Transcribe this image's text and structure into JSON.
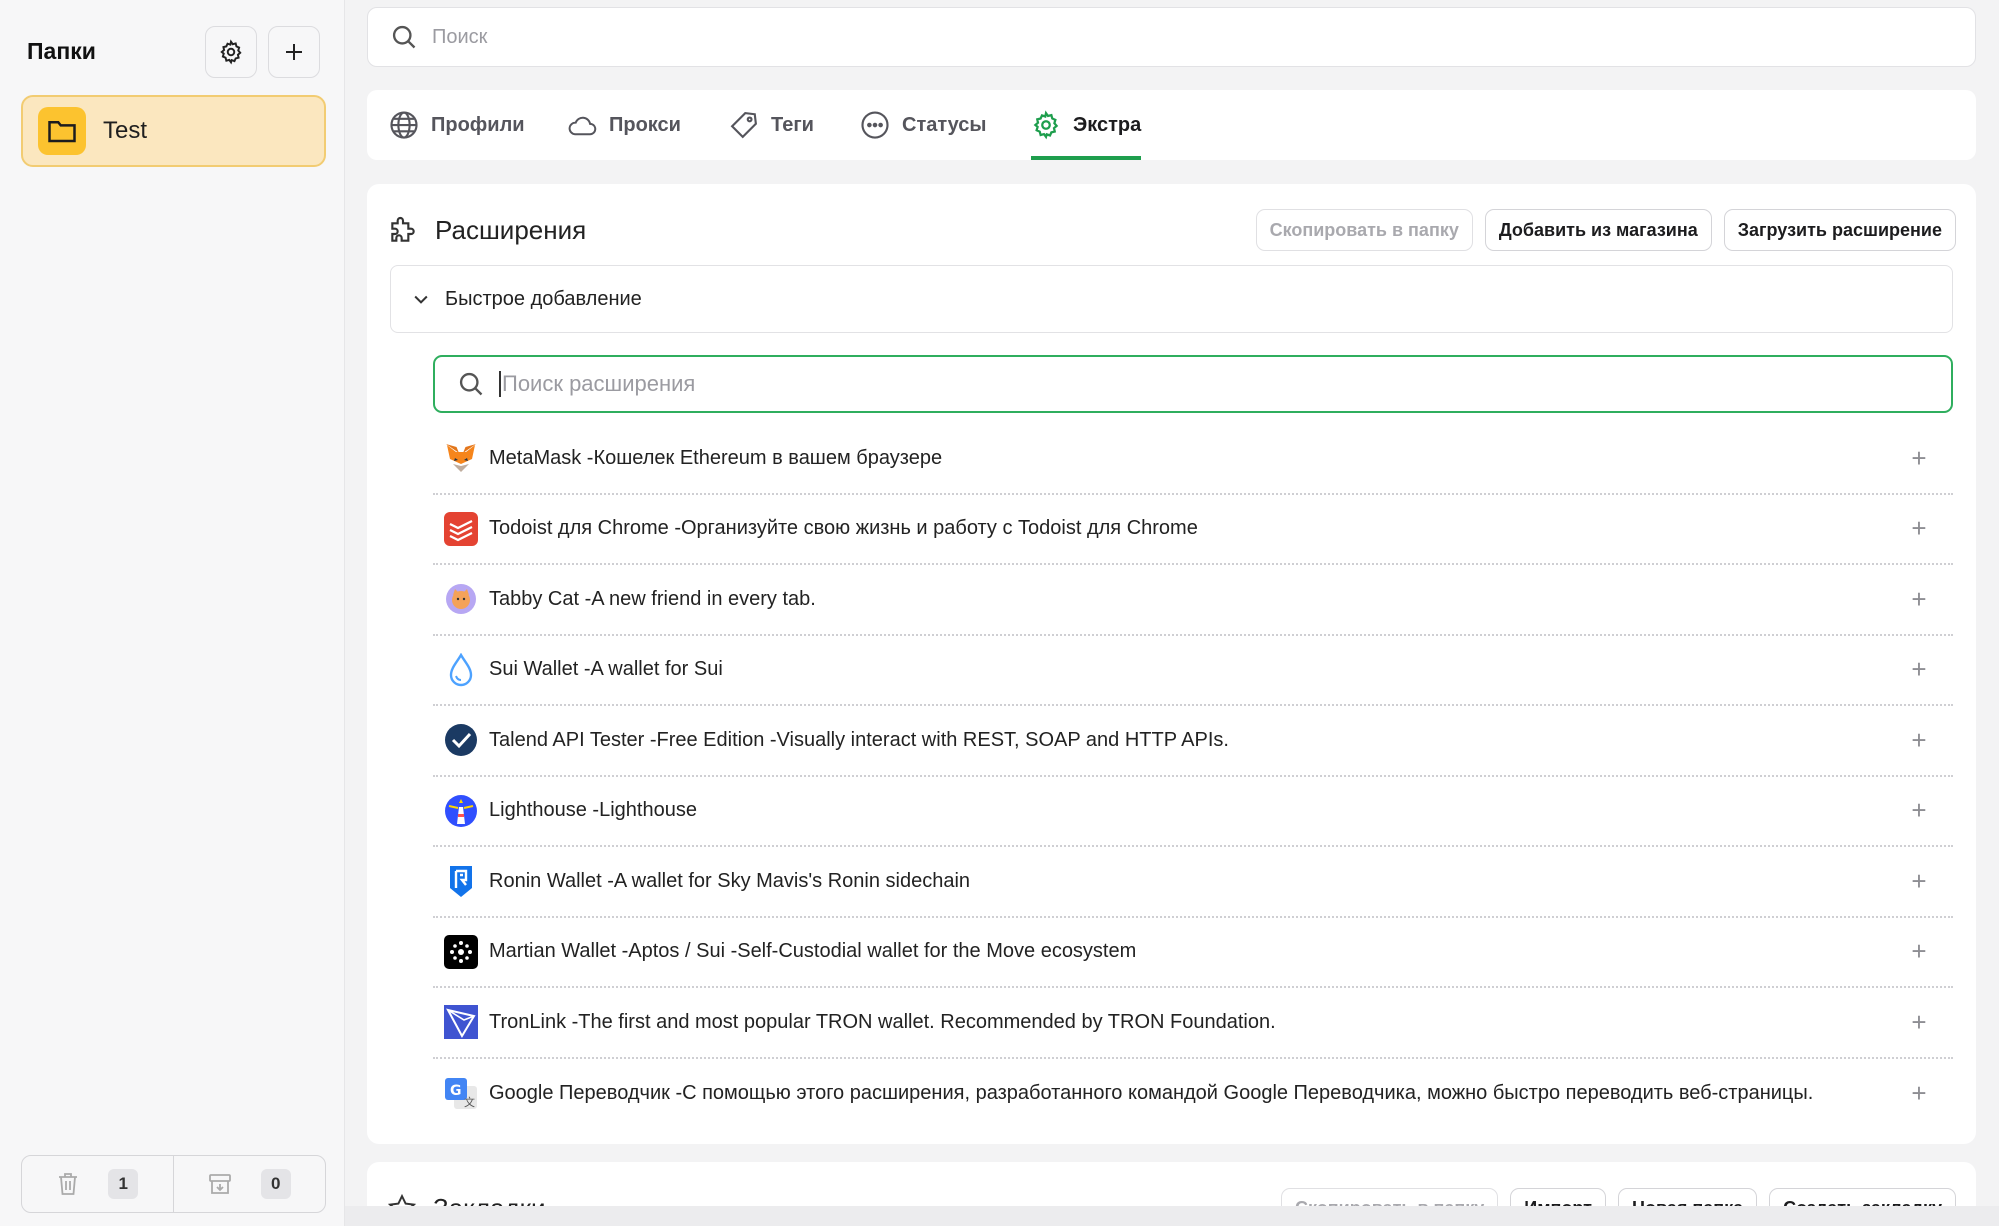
{
  "sidebar": {
    "title": "Папки",
    "folders": [
      {
        "name": "Test"
      }
    ],
    "bottom": {
      "trash_count": "1",
      "archive_count": "0"
    }
  },
  "search": {
    "placeholder": "Поиск"
  },
  "tabs": [
    {
      "label": "Профили",
      "icon": "globe-icon"
    },
    {
      "label": "Прокси",
      "icon": "cloud-icon"
    },
    {
      "label": "Теги",
      "icon": "tag-icon"
    },
    {
      "label": "Статусы",
      "icon": "dots-circle-icon"
    },
    {
      "label": "Экстра",
      "icon": "gear-icon",
      "active": true
    }
  ],
  "extensions": {
    "title": "Расширения",
    "copy_button": "Скопировать в папку",
    "store_button": "Добавить из магазина",
    "upload_button": "Загрузить расширение",
    "quick_add": "Быстрое добавление",
    "search_placeholder": "Поиск расширения",
    "items": [
      {
        "text": "MetaMask -Кошелек Ethereum в вашем браузере"
      },
      {
        "text": "Todoist для Chrome -Организуйте свою жизнь и работу с Todoist для Chrome"
      },
      {
        "text": "Tabby Cat -A new friend in every tab."
      },
      {
        "text": "Sui Wallet -A wallet for Sui"
      },
      {
        "text": "Talend API Tester -Free Edition -Visually interact with REST, SOAP and HTTP APIs."
      },
      {
        "text": "Lighthouse -Lighthouse"
      },
      {
        "text": "Ronin Wallet -A wallet for Sky Mavis's Ronin sidechain"
      },
      {
        "text": "Martian Wallet -Aptos / Sui -Self-Custodial wallet for the Move ecosystem"
      },
      {
        "text": "TronLink -The first and most popular TRON wallet. Recommended by TRON Foundation."
      },
      {
        "text": "Google Переводчик -С помощью этого расширения, разработанного командой Google Переводчика, можно быстро переводить веб-страницы."
      }
    ],
    "add_symbol": "+"
  },
  "bookmarks": {
    "title": "Закладки",
    "copy_button": "Скопировать в папку",
    "import_button": "Импорт",
    "new_folder_button": "Новая папка",
    "create_button": "Создать закладку"
  },
  "colors": {
    "accent": "#1e9e4d",
    "folder_bg": "#fbe7bf",
    "folder_icon": "#fcc32f"
  }
}
